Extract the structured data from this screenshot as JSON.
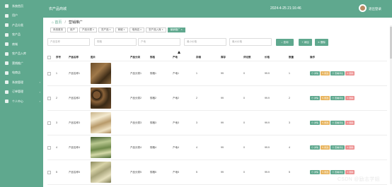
{
  "sidebar": {
    "items": [
      {
        "label": "系统首页",
        "chevron": ""
      },
      {
        "label": "用户",
        "chevron": ""
      },
      {
        "label": "产品分类",
        "chevron": ""
      },
      {
        "label": "农产品",
        "chevron": ""
      },
      {
        "label": "商城",
        "chevron": ""
      },
      {
        "label": "农产品入库",
        "chevron": ""
      },
      {
        "label": "营销推广",
        "chevron": ""
      },
      {
        "label": "电商店",
        "chevron": ""
      },
      {
        "label": "系统管理",
        "chevron": "›"
      },
      {
        "label": "订单管理",
        "chevron": "›"
      },
      {
        "label": "个人中心",
        "chevron": "›"
      }
    ]
  },
  "topbar": {
    "title": "农产品商城",
    "time": "2024-4-25 21:16:46",
    "user": "退出登录"
  },
  "breadcrumb": {
    "home": "首页",
    "current": "营销推广"
  },
  "tabs": [
    "系统首页",
    "用户",
    "产品分类 ×",
    "农产品 ×",
    "商城 ×",
    "电商店 ×",
    "农产品入库 ×",
    "营销推广 ×"
  ],
  "filters": {
    "placeholders": [
      "产品名称",
      "规格",
      "产地",
      "最小价格",
      "最大价格"
    ],
    "search_label": "查询",
    "add_label": "添加",
    "delete_label": "删除"
  },
  "table": {
    "headers": [
      "序号",
      "产品名称",
      "图片",
      "产品分类",
      "规格",
      "产地",
      "存储",
      "库存",
      "评论数",
      "价格",
      "数量",
      "操作"
    ],
    "rows": [
      {
        "idx": "1",
        "name": "产品名称1",
        "cat": "产品分类1",
        "spec": "规格1",
        "origin": "产地1",
        "store": "1",
        "stock": "99",
        "comments": "0",
        "price": "99.9",
        "qty": "1"
      },
      {
        "idx": "2",
        "name": "产品名称2",
        "cat": "产品分类2",
        "spec": "规格2",
        "origin": "产地2",
        "store": "2",
        "stock": "99",
        "comments": "0",
        "price": "99.9",
        "qty": "2"
      },
      {
        "idx": "3",
        "name": "产品名称3",
        "cat": "产品分类3",
        "spec": "规格3",
        "origin": "产地3",
        "store": "3",
        "stock": "99",
        "comments": "0",
        "price": "99.9",
        "qty": "3"
      },
      {
        "idx": "4",
        "name": "产品名称4",
        "cat": "产品分类4",
        "spec": "规格4",
        "origin": "产地4",
        "store": "4",
        "stock": "99",
        "comments": "0",
        "price": "99.9",
        "qty": "4"
      },
      {
        "idx": "5",
        "name": "产品名称5",
        "cat": "产品分类5",
        "spec": "规格5",
        "origin": "产地5",
        "store": "5",
        "stock": "99",
        "comments": "0",
        "price": "99.9",
        "qty": "5"
      }
    ],
    "actions": {
      "view": "详情",
      "edit": "修改",
      "review": "查看评论",
      "delete": "删除"
    }
  },
  "watermark": "CSDN @励志学姐",
  "colors": {
    "accent": "#5fa88e",
    "edit": "#e8b55f",
    "danger": "#ec8f8f"
  }
}
